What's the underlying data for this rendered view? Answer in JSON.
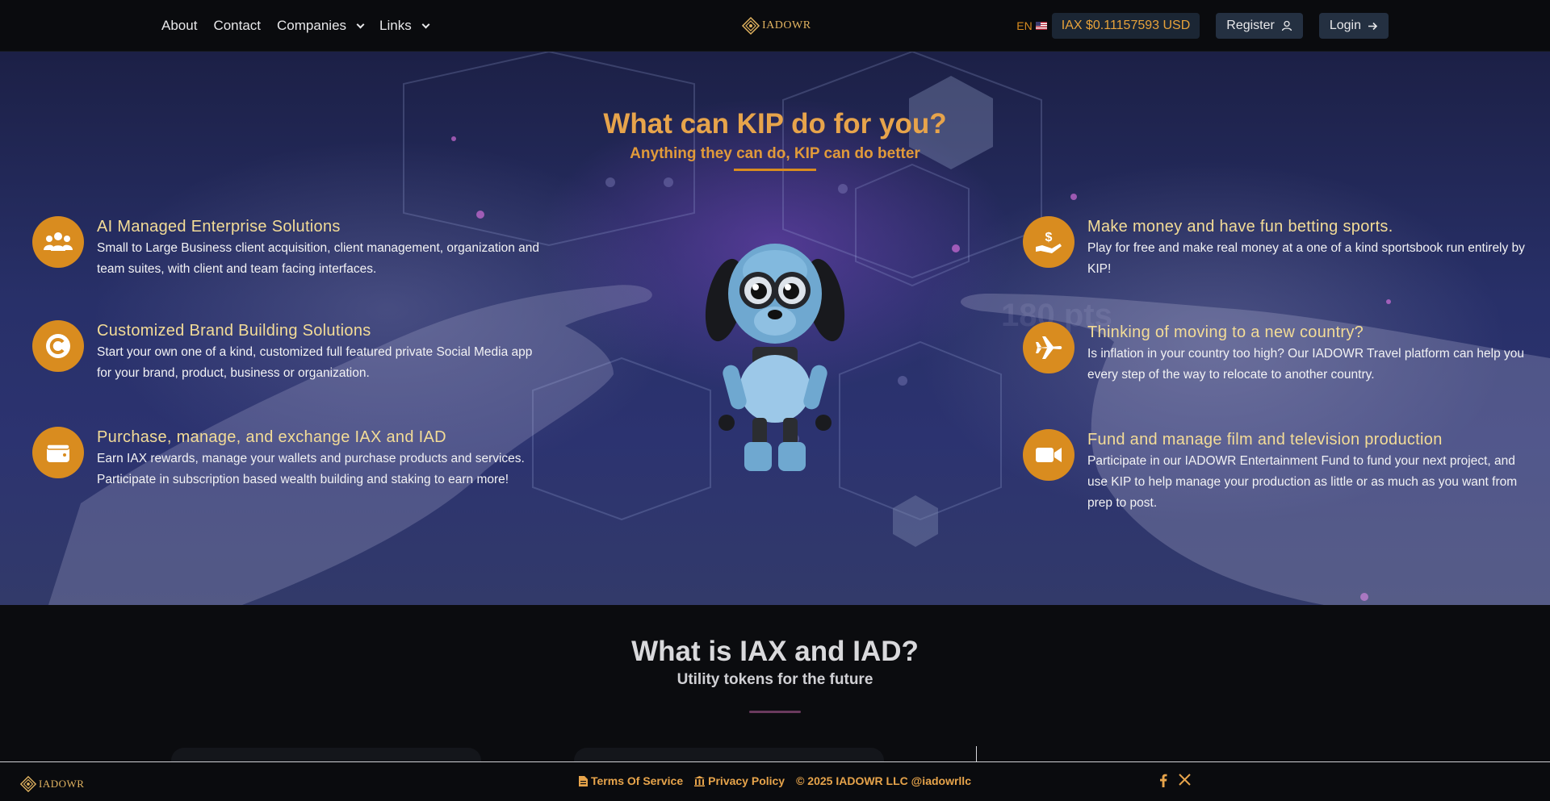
{
  "nav": {
    "links": [
      "About",
      "Contact",
      "Companies",
      "Links"
    ],
    "brand": "IADOWR",
    "lang": "EN",
    "price": "IAX $0.11157593 USD",
    "register": "Register",
    "login": "Login"
  },
  "hero": {
    "title": "What can KIP do for you?",
    "subtitle": "Anything they can do, KIP can do better",
    "features_left": [
      {
        "icon": "people-icon",
        "title": "AI Managed Enterprise Solutions",
        "desc": "Small to Large Business client acquisition, client management, organization and team suites, with client and team facing interfaces."
      },
      {
        "icon": "copyright-icon",
        "title": "Customized Brand Building Solutions",
        "desc": "Start your own one of a kind, customized full featured private Social Media app for your brand, product, business or organization."
      },
      {
        "icon": "wallet-icon",
        "title": "Purchase, manage, and exchange IAX and IAD",
        "desc": "Earn IAX rewards, manage your wallets and purchase products and services. Participate in subscription based wealth building and staking to earn more!"
      }
    ],
    "features_right": [
      {
        "icon": "money-hand-icon",
        "title": "Make money and have fun betting sports.",
        "desc": "Play for free and make real money at a one of a kind sportsbook run entirely by KIP!"
      },
      {
        "icon": "airplane-icon",
        "title": "Thinking of moving to a new country?",
        "desc": "Is inflation in your country too high? Our IADOWR Travel platform can help you every step of the way to relocate to another country."
      },
      {
        "icon": "video-camera-icon",
        "title": "Fund and manage film and television production",
        "desc": "Participate in our IADOWR Entertainment Fund to fund your next project, and use KIP to help manage your production as little or as much as you want from prep to post."
      }
    ]
  },
  "section2": {
    "title": "What is IAX and IAD?",
    "subtitle": "Utility tokens for the future"
  },
  "footer": {
    "brand": "IADOWR",
    "terms": "Terms Of Service",
    "privacy": "Privacy Policy",
    "copyright": "© 2025 IADOWR LLC @iadowrllc",
    "social": [
      "facebook-icon",
      "x-icon"
    ]
  },
  "colors": {
    "accent": "#d98c1f",
    "title_gold": "#e7a44b",
    "feature_title": "#f3dc97",
    "nav_bg": "#0a0b0e"
  }
}
